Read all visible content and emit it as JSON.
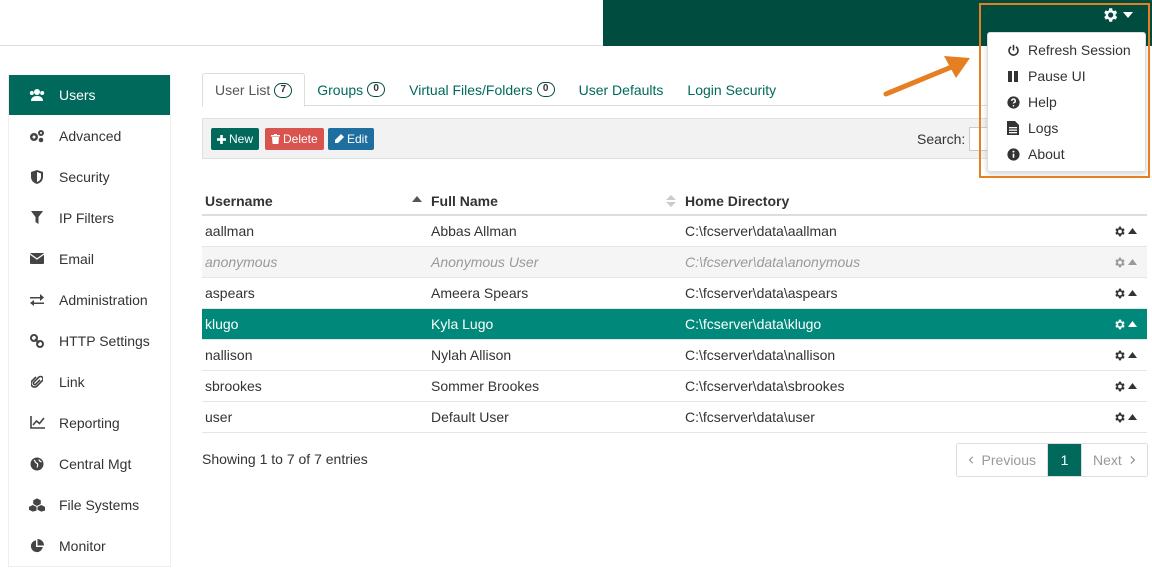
{
  "menu": {
    "items": [
      {
        "label": "Refresh Session",
        "icon": "power-icon"
      },
      {
        "label": "Pause UI",
        "icon": "pause-icon"
      },
      {
        "label": "Help",
        "icon": "help-icon"
      },
      {
        "label": "Logs",
        "icon": "file-icon"
      },
      {
        "label": "About",
        "icon": "info-icon"
      }
    ]
  },
  "sidebar": {
    "items": [
      {
        "label": "Users",
        "icon": "users-icon",
        "active": true
      },
      {
        "label": "Advanced",
        "icon": "cogs-icon"
      },
      {
        "label": "Security",
        "icon": "shield-icon"
      },
      {
        "label": "IP Filters",
        "icon": "filter-icon"
      },
      {
        "label": "Email",
        "icon": "envelope-icon"
      },
      {
        "label": "Administration",
        "icon": "exchange-icon"
      },
      {
        "label": "HTTP Settings",
        "icon": "link-icon"
      },
      {
        "label": "Link",
        "icon": "paperclip-icon"
      },
      {
        "label": "Reporting",
        "icon": "chart-icon"
      },
      {
        "label": "Central Mgt",
        "icon": "globe-icon"
      },
      {
        "label": "File Systems",
        "icon": "cubes-icon"
      },
      {
        "label": "Monitor",
        "icon": "pie-icon"
      }
    ]
  },
  "tabs": [
    {
      "label": "User List",
      "badge": "7",
      "active": true
    },
    {
      "label": "Groups",
      "badge": "0"
    },
    {
      "label": "Virtual Files/Folders",
      "badge": "0"
    },
    {
      "label": "User Defaults"
    },
    {
      "label": "Login Security"
    }
  ],
  "toolbar": {
    "new_label": "New",
    "delete_label": "Delete",
    "edit_label": "Edit",
    "search_label": "Search:",
    "search_value": ""
  },
  "table": {
    "headers": {
      "username": "Username",
      "fullname": "Full Name",
      "home": "Home Directory"
    },
    "rows": [
      {
        "username": "aallman",
        "fullname": "Abbas Allman",
        "home": "C:\\fcserver\\data\\aallman",
        "state": "normal"
      },
      {
        "username": "anonymous",
        "fullname": "Anonymous User",
        "home": "C:\\fcserver\\data\\anonymous",
        "state": "disabled"
      },
      {
        "username": "aspears",
        "fullname": "Ameera Spears",
        "home": "C:\\fcserver\\data\\aspears",
        "state": "normal"
      },
      {
        "username": "klugo",
        "fullname": "Kyla Lugo",
        "home": "C:\\fcserver\\data\\klugo",
        "state": "selected"
      },
      {
        "username": "nallison",
        "fullname": "Nylah Allison",
        "home": "C:\\fcserver\\data\\nallison",
        "state": "normal"
      },
      {
        "username": "sbrookes",
        "fullname": "Sommer Brookes",
        "home": "C:\\fcserver\\data\\sbrookes",
        "state": "normal"
      },
      {
        "username": "user",
        "fullname": "Default User",
        "home": "C:\\fcserver\\data\\user",
        "state": "normal"
      }
    ]
  },
  "footer": {
    "entries_info": "Showing 1 to 7 of 7 entries",
    "prev_label": "Previous",
    "current_page": "1",
    "next_label": "Next"
  },
  "colors": {
    "brand": "#004d40",
    "accent": "#00695c",
    "selected_row": "#00897b",
    "annotation": "#e67e22"
  }
}
